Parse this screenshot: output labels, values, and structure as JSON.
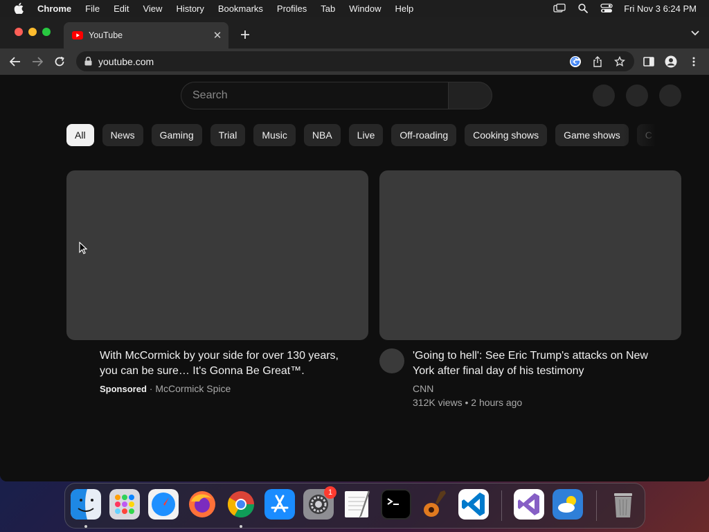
{
  "menubar": {
    "app_name": "Chrome",
    "items": [
      "File",
      "Edit",
      "View",
      "History",
      "Bookmarks",
      "Profiles",
      "Tab",
      "Window",
      "Help"
    ],
    "clock": "Fri Nov 3  6:24 PM"
  },
  "browser": {
    "tab_title": "YouTube",
    "tab_close": "✕",
    "new_tab": "+",
    "url": "youtube.com"
  },
  "youtube": {
    "search_placeholder": "Search",
    "chips": [
      "All",
      "News",
      "Gaming",
      "Trial",
      "Music",
      "NBA",
      "Live",
      "Off-roading",
      "Cooking shows",
      "Game shows",
      "C"
    ],
    "active_chip": "All",
    "videos": [
      {
        "title": "With McCormick by your side for over 130 years, you can be sure… It's Gonna Be Great™.",
        "sponsored_label": "Sponsored",
        "separator": "·",
        "channel": "McCormick Spice"
      },
      {
        "title": "'Going to hell': See Eric Trump's attacks on New York after final day of his testimony",
        "channel": "CNN",
        "stats": "312K views • 2 hours ago"
      }
    ]
  },
  "dock": {
    "apps": [
      "Finder",
      "Launchpad",
      "Safari",
      "Firefox",
      "Chrome",
      "App Store",
      "System Settings",
      "TextEdit",
      "Terminal",
      "GarageBand",
      "Visual Studio Code",
      "Visual Studio",
      "Weather",
      "Trash"
    ],
    "settings_badge": "1"
  },
  "colors": {
    "accent_red": "#ff0000",
    "page_bg": "#0f0f0f",
    "chip_bg": "#272727"
  }
}
